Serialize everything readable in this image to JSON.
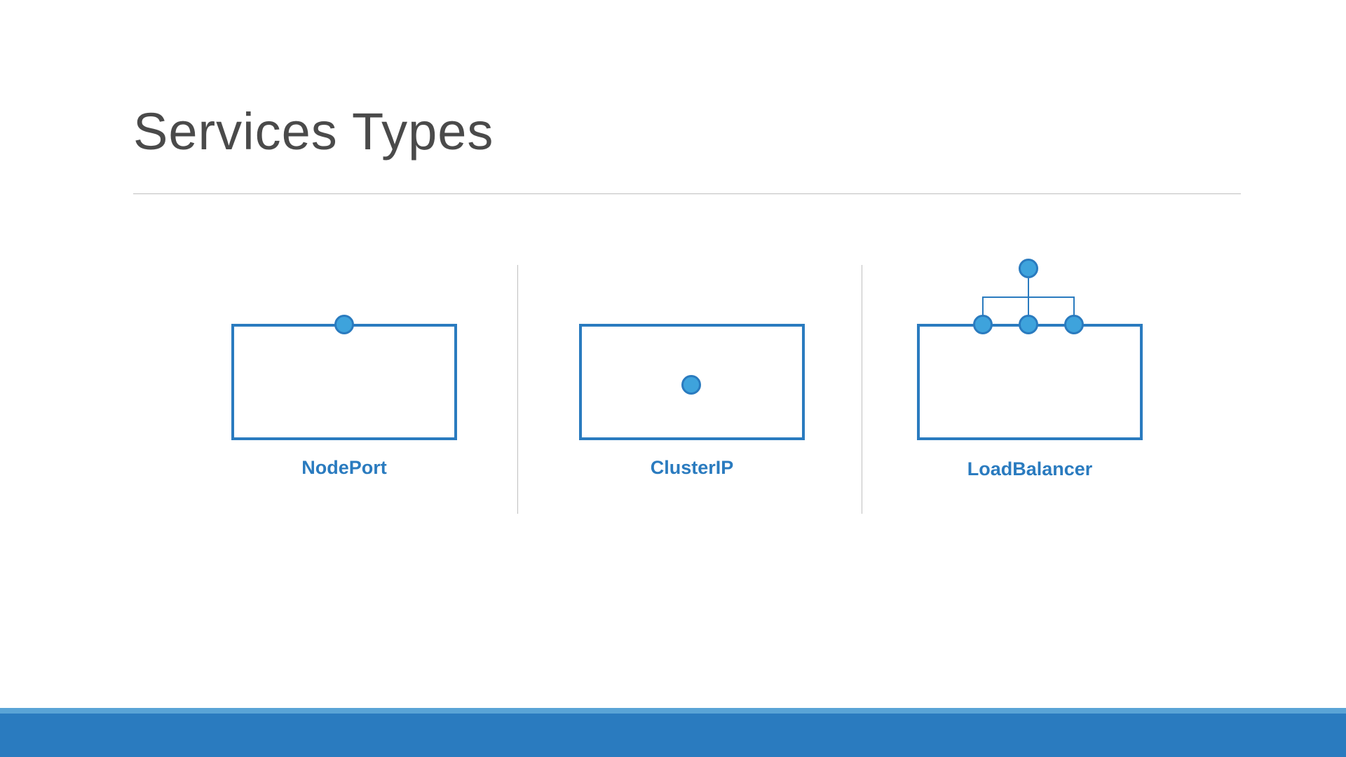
{
  "title": "Services Types",
  "items": [
    {
      "label": "NodePort"
    },
    {
      "label": "ClusterIP"
    },
    {
      "label": "LoadBalancer"
    }
  ],
  "colors": {
    "accent": "#2a7bbf",
    "accentLight": "#5aa4d6",
    "circleFill": "#3ea3dc",
    "textGray": "#4a4a4a",
    "ruleGray": "#bfbfbf"
  }
}
